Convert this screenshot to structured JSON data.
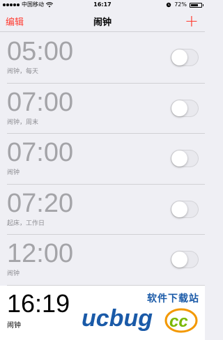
{
  "status_bar": {
    "carrier": "中国移动",
    "time": "16:17",
    "battery": "72%",
    "battery_level": 0.72
  },
  "nav": {
    "edit_label": "编辑",
    "title": "闹钟",
    "add_label": "+"
  },
  "alarms": [
    {
      "time": "05:00",
      "label": "闹钟，每天",
      "enabled": false
    },
    {
      "time": "07:00",
      "label": "闹钟，周末",
      "enabled": false
    },
    {
      "time": "07:00",
      "label": "闹钟",
      "enabled": false
    },
    {
      "time": "07:20",
      "label": "起床，工作日",
      "enabled": false
    },
    {
      "time": "12:00",
      "label": "闹钟",
      "enabled": false
    }
  ],
  "active_alarm": {
    "time": "16:19",
    "label": "闹钟"
  },
  "watermark": {
    "text_cn": "软件下载站",
    "logo_text": "ucbug",
    "logo_suffix": "cc"
  },
  "colors": {
    "accent": "#ff3b30",
    "background": "#efeff4",
    "disabled_text": "#a4a4a8",
    "watermark_blue": "#1a5aa8",
    "watermark_orange": "#f39800"
  },
  "icons": {
    "wifi": "wifi-icon",
    "alarm_clock": "alarm-clock-icon",
    "battery": "battery-icon"
  }
}
